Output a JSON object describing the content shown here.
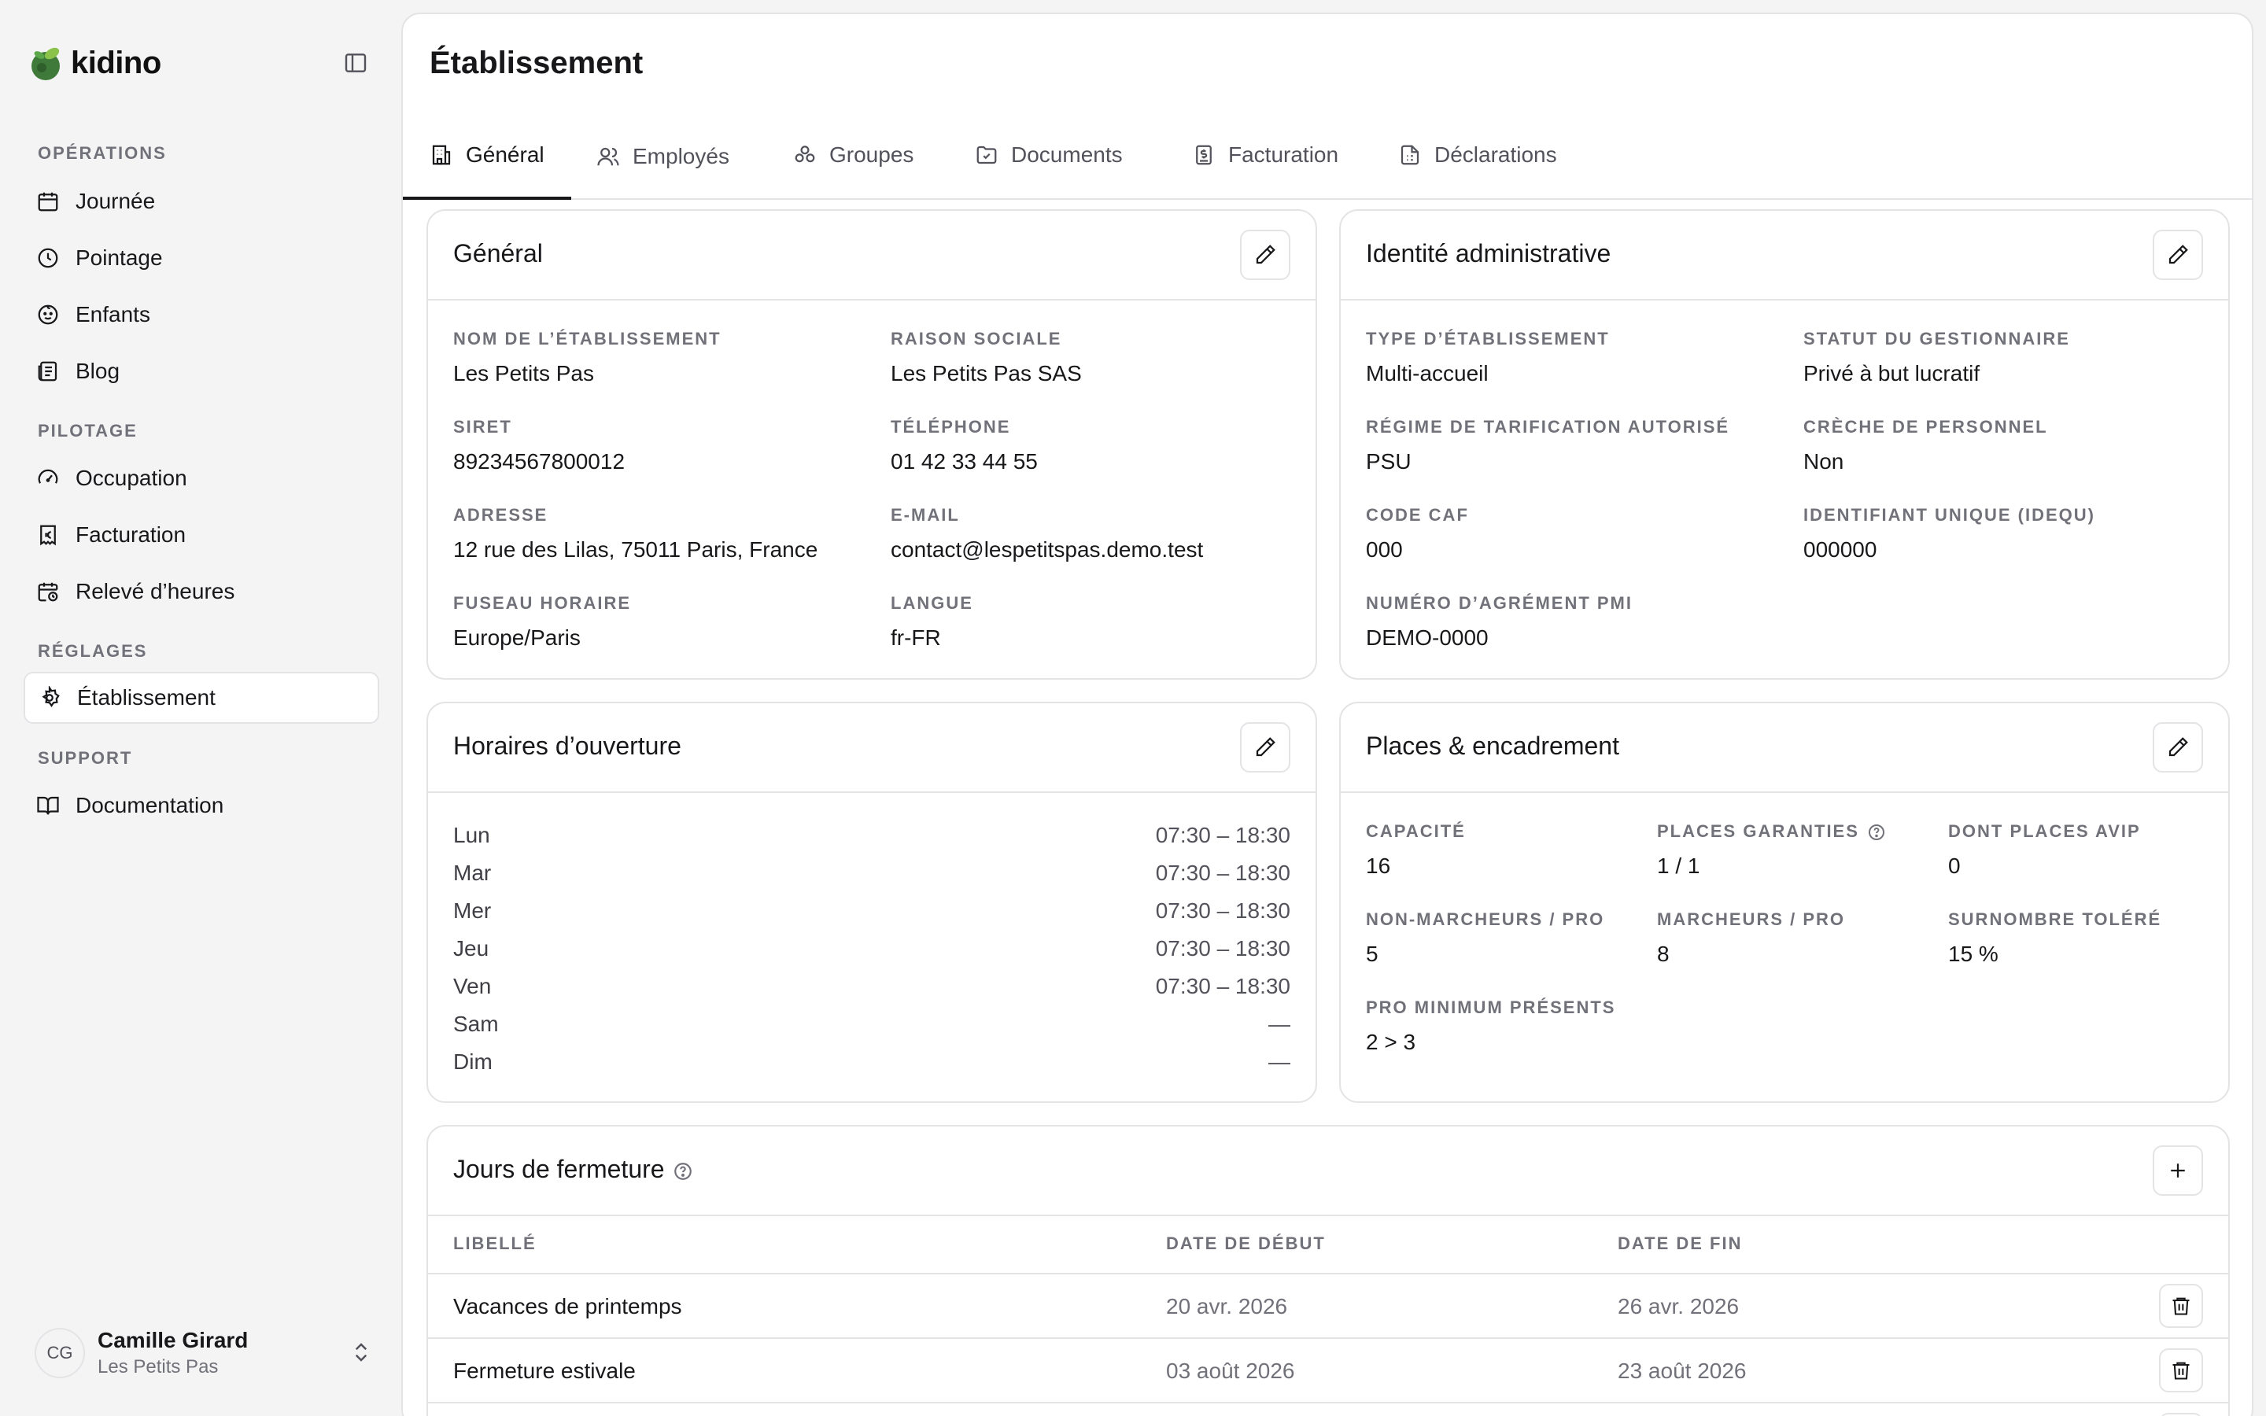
{
  "brand": {
    "name": "kidino"
  },
  "sidebar": {
    "sections": [
      {
        "title": "OPÉRATIONS",
        "items": [
          "Journée",
          "Pointage",
          "Enfants",
          "Blog"
        ]
      },
      {
        "title": "PILOTAGE",
        "items": [
          "Occupation",
          "Facturation",
          "Relevé d’heures"
        ]
      },
      {
        "title": "RÉGLAGES",
        "items": [
          "Établissement"
        ]
      },
      {
        "title": "SUPPORT",
        "items": [
          "Documentation"
        ]
      }
    ],
    "active_item": "Établissement"
  },
  "user": {
    "initials": "CG",
    "name": "Camille Girard",
    "org": "Les Petits Pas"
  },
  "page": {
    "title": "Établissement"
  },
  "tabs": [
    {
      "label": "Général",
      "icon": "building-icon",
      "active": true
    },
    {
      "label": "Employés",
      "icon": "users-icon"
    },
    {
      "label": "Groupes",
      "icon": "groups-icon"
    },
    {
      "label": "Documents",
      "icon": "folder-icon"
    },
    {
      "label": "Facturation",
      "icon": "invoice-icon"
    },
    {
      "label": "Déclarations",
      "icon": "file-text-icon"
    }
  ],
  "general": {
    "title": "Général",
    "fields": [
      {
        "label": "NOM DE L’ÉTABLISSEMENT",
        "value": "Les Petits Pas"
      },
      {
        "label": "RAISON SOCIALE",
        "value": "Les Petits Pas SAS"
      },
      {
        "label": "SIRET",
        "value": "89234567800012"
      },
      {
        "label": "TÉLÉPHONE",
        "value": "01 42 33 44 55"
      },
      {
        "label": "ADRESSE",
        "value": "12 rue des Lilas, 75011 Paris, France"
      },
      {
        "label": "E-MAIL",
        "value": "contact@lespetitspas.demo.test"
      },
      {
        "label": "FUSEAU HORAIRE",
        "value": "Europe/Paris"
      },
      {
        "label": "LANGUE",
        "value": "fr-FR"
      }
    ]
  },
  "identity": {
    "title": "Identité administrative",
    "fields": [
      {
        "label": "TYPE D’ÉTABLISSEMENT",
        "value": "Multi-accueil"
      },
      {
        "label": "STATUT DU GESTIONNAIRE",
        "value": "Privé à but lucratif"
      },
      {
        "label": "RÉGIME DE TARIFICATION AUTORISÉ",
        "value": "PSU"
      },
      {
        "label": "CRÈCHE DE PERSONNEL",
        "value": "Non"
      },
      {
        "label": "CODE CAF",
        "value": "000"
      },
      {
        "label": "IDENTIFIANT UNIQUE (IDEQU)",
        "value": "000000"
      },
      {
        "label": "NUMÉRO D’AGRÉMENT PMI",
        "value": "DEMO-0000"
      }
    ]
  },
  "hours": {
    "title": "Horaires d’ouverture",
    "rows": [
      {
        "day": "Lun",
        "value": "07:30 – 18:30"
      },
      {
        "day": "Mar",
        "value": "07:30 – 18:30"
      },
      {
        "day": "Mer",
        "value": "07:30 – 18:30"
      },
      {
        "day": "Jeu",
        "value": "07:30 – 18:30"
      },
      {
        "day": "Ven",
        "value": "07:30 – 18:30"
      },
      {
        "day": "Sam",
        "value": "—"
      },
      {
        "day": "Dim",
        "value": "—"
      }
    ]
  },
  "places": {
    "title": "Places & encadrement",
    "fields": [
      {
        "label": "CAPACITÉ",
        "value": "16"
      },
      {
        "label": "PLACES GARANTIES",
        "value": "1 / 1",
        "help": true
      },
      {
        "label": "DONT PLACES AVIP",
        "value": "0"
      },
      {
        "label": "NON-MARCHEURS / PRO",
        "value": "5"
      },
      {
        "label": "MARCHEURS / PRO",
        "value": "8"
      },
      {
        "label": "SURNOMBRE TOLÉRÉ",
        "value": "15 %"
      },
      {
        "label": "PRO MINIMUM PRÉSENTS",
        "value": "2 > 3"
      }
    ]
  },
  "closures": {
    "title": "Jours de fermeture",
    "columns": [
      "LIBELLÉ",
      "DATE DE DÉBUT",
      "DATE DE FIN"
    ],
    "rows": [
      {
        "label": "Vacances de printemps",
        "start": "20 avr. 2026",
        "end": "26 avr. 2026"
      },
      {
        "label": "Fermeture estivale",
        "start": "03 août 2026",
        "end": "23 août 2026"
      }
    ]
  }
}
